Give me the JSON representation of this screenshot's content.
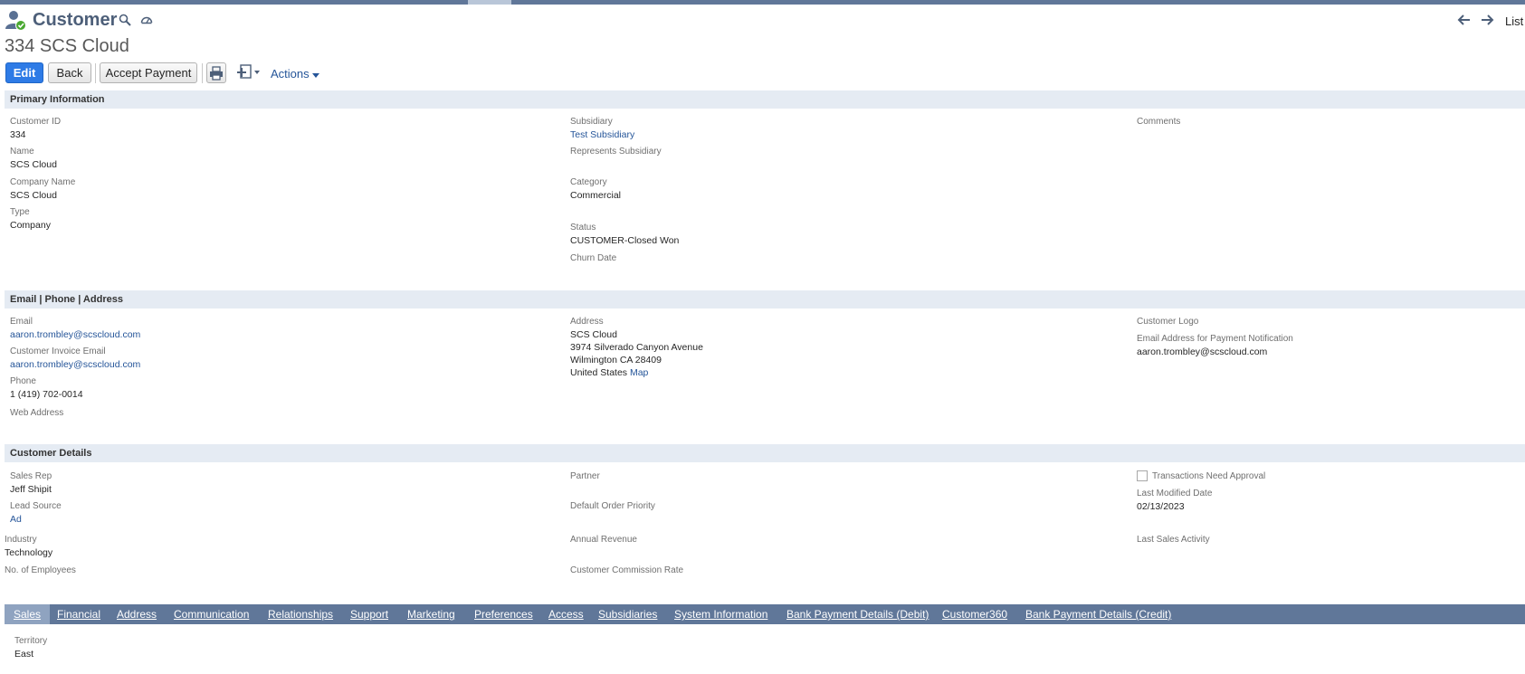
{
  "header": {
    "record_type": "Customer",
    "record_name": "334 SCS Cloud",
    "list_label": "List"
  },
  "toolbar": {
    "edit_label": "Edit",
    "back_label": "Back",
    "accept_payment_label": "Accept Payment",
    "actions_label": "Actions"
  },
  "primary": {
    "title": "Primary Information",
    "customer_id_label": "Customer ID",
    "customer_id": "334",
    "name_label": "Name",
    "name": "SCS Cloud",
    "company_name_label": "Company Name",
    "company_name": "SCS Cloud",
    "type_label": "Type",
    "type": "Company",
    "subsidiary_label": "Subsidiary",
    "subsidiary": "Test Subsidiary",
    "represents_subsidiary_label": "Represents Subsidiary",
    "category_label": "Category",
    "category": "Commercial",
    "status_label": "Status",
    "status": "CUSTOMER-Closed Won",
    "churn_date_label": "Churn Date",
    "comments_label": "Comments"
  },
  "contact": {
    "title": "Email | Phone | Address",
    "email_label": "Email",
    "email": "aaron.trombley@scscloud.com",
    "invoice_email_label": "Customer Invoice Email",
    "invoice_email": "aaron.trombley@scscloud.com",
    "phone_label": "Phone",
    "phone": "1 (419) 702-0014",
    "web_address_label": "Web Address",
    "address_label": "Address",
    "address_line1": "SCS Cloud",
    "address_line2": "3974 Silverado Canyon Avenue",
    "address_line3": "Wilmington CA 28409",
    "address_country": "United States",
    "map_link": "Map",
    "logo_label": "Customer Logo",
    "payment_notification_label": "Email Address for Payment Notification",
    "payment_notification_email": "aaron.trombley@scscloud.com"
  },
  "details": {
    "title": "Customer Details",
    "sales_rep_label": "Sales Rep",
    "sales_rep": "Jeff Shipit",
    "lead_source_label": "Lead Source",
    "lead_source": "Ad",
    "industry_label": "Industry",
    "industry": "Technology",
    "employees_label": "No. of Employees",
    "partner_label": "Partner",
    "order_priority_label": "Default Order Priority",
    "annual_revenue_label": "Annual Revenue",
    "commission_rate_label": "Customer Commission Rate",
    "transactions_approval_label": "Transactions Need Approval",
    "last_modified_label": "Last Modified Date",
    "last_modified": "02/13/2023",
    "last_sales_activity_label": "Last Sales Activity"
  },
  "tabs": [
    {
      "label": "Sales"
    },
    {
      "label": "Financial"
    },
    {
      "label": "Address"
    },
    {
      "label": "Communication"
    },
    {
      "label": "Relationships"
    },
    {
      "label": "Support"
    },
    {
      "label": "Marketing"
    },
    {
      "label": "Preferences"
    },
    {
      "label": "Access"
    },
    {
      "label": "Subsidiaries"
    },
    {
      "label": "System Information"
    },
    {
      "label": "Bank Payment Details (Debit)"
    },
    {
      "label": "Customer360"
    },
    {
      "label": "Bank Payment Details (Credit)"
    }
  ],
  "sales_tab": {
    "territory_label": "Territory",
    "territory": "East"
  },
  "colors": {
    "accent": "#2e7be6",
    "tab_bar": "#607799",
    "section_bar": "#e5ebf3",
    "link": "#255599",
    "title": "#4d5f79"
  },
  "icons": [
    "customer-icon",
    "search-icon",
    "dashboard-icon",
    "arrow-left-icon",
    "arrow-right-icon",
    "print-icon",
    "new-record-icon",
    "caret-down-icon"
  ]
}
